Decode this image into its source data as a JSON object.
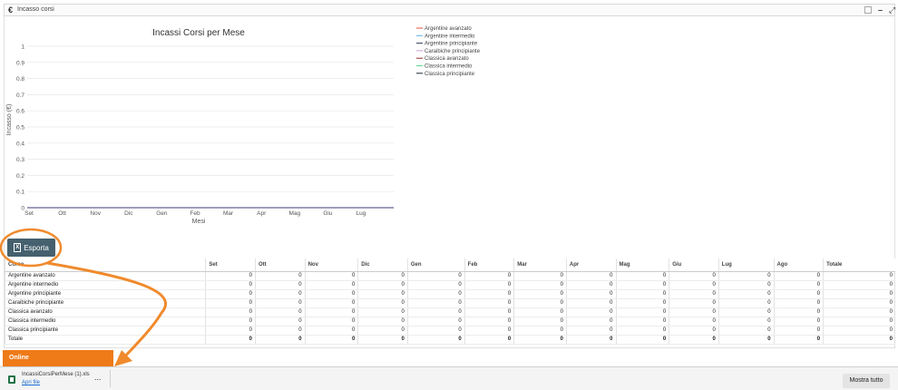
{
  "panel": {
    "icon": "euro-icon",
    "title": "Incasso corsi",
    "controls": [
      "checkbox-icon",
      "minimize-icon",
      "expand-icon"
    ]
  },
  "chart_data": {
    "type": "line",
    "title": "Incassi Corsi per Mese",
    "xlabel": "Mesi",
    "ylabel": "Incasso (€)",
    "categories": [
      "Set",
      "Ott",
      "Nov",
      "Dic",
      "Gen",
      "Feb",
      "Mar",
      "Apr",
      "Mag",
      "Giu",
      "Lug"
    ],
    "ylim": [
      0,
      1
    ],
    "yticks": [
      "0",
      "0.1",
      "0.2",
      "0.3",
      "0.4",
      "0.5",
      "0.6",
      "0.7",
      "0.8",
      "0.9",
      "1"
    ],
    "grid": true,
    "legend_position": "top-right",
    "series": [
      {
        "name": "Argentine avanzato",
        "color": "#e74c3c",
        "values": [
          0,
          0,
          0,
          0,
          0,
          0,
          0,
          0,
          0,
          0,
          0
        ]
      },
      {
        "name": "Argentine intermedio",
        "color": "#5dade2",
        "values": [
          0,
          0,
          0,
          0,
          0,
          0,
          0,
          0,
          0,
          0,
          0
        ]
      },
      {
        "name": "Argentine principiante",
        "color": "#2e4053",
        "values": [
          0,
          0,
          0,
          0,
          0,
          0,
          0,
          0,
          0,
          0,
          0
        ]
      },
      {
        "name": "Caraibiche principiante",
        "color": "#c39bd3",
        "values": [
          0,
          0,
          0,
          0,
          0,
          0,
          0,
          0,
          0,
          0,
          0
        ]
      },
      {
        "name": "Classica avanzato",
        "color": "#922b21",
        "values": [
          0,
          0,
          0,
          0,
          0,
          0,
          0,
          0,
          0,
          0,
          0
        ]
      },
      {
        "name": "Classica intermedio",
        "color": "#58d68d",
        "values": [
          0,
          0,
          0,
          0,
          0,
          0,
          0,
          0,
          0,
          0,
          0
        ]
      },
      {
        "name": "Classica principiante",
        "color": "#1c2833",
        "values": [
          0,
          0,
          0,
          0,
          0,
          0,
          0,
          0,
          0,
          0,
          0
        ]
      }
    ]
  },
  "export_button": {
    "label": "Esporta",
    "icon": "excel-icon"
  },
  "table": {
    "headers": [
      "Corso",
      "Set",
      "Ott",
      "Nov",
      "Dic",
      "Gen",
      "Feb",
      "Mar",
      "Apr",
      "Mag",
      "Giu",
      "Lug",
      "Ago",
      "Totale"
    ],
    "rows": [
      {
        "name": "Argentine avanzato",
        "values": [
          "0",
          "0",
          "0",
          "0",
          "0",
          "0",
          "0",
          "0",
          "0",
          "0",
          "0",
          "0",
          "0"
        ]
      },
      {
        "name": "Argentine intermedio",
        "values": [
          "0",
          "0",
          "0",
          "0",
          "0",
          "0",
          "0",
          "0",
          "0",
          "0",
          "0",
          "0",
          "0"
        ]
      },
      {
        "name": "Argentine principiante",
        "values": [
          "0",
          "0",
          "0",
          "0",
          "0",
          "0",
          "0",
          "0",
          "0",
          "0",
          "0",
          "0",
          "0"
        ]
      },
      {
        "name": "Caraibiche principiante",
        "values": [
          "0",
          "0",
          "0",
          "0",
          "0",
          "0",
          "0",
          "0",
          "0",
          "0",
          "0",
          "0",
          "0"
        ]
      },
      {
        "name": "Classica avanzato",
        "values": [
          "0",
          "0",
          "0",
          "0",
          "0",
          "0",
          "0",
          "0",
          "0",
          "0",
          "0",
          "0",
          "0"
        ]
      },
      {
        "name": "Classica intermedio",
        "values": [
          "0",
          "0",
          "0",
          "0",
          "0",
          "0",
          "0",
          "0",
          "0",
          "0",
          "0",
          "0",
          "0"
        ]
      },
      {
        "name": "Classica principiante",
        "values": [
          "0",
          "0",
          "0",
          "0",
          "0",
          "0",
          "0",
          "0",
          "0",
          "0",
          "0",
          "0",
          "0"
        ]
      }
    ],
    "total_row": {
      "name": "Totale",
      "values": [
        "0",
        "0",
        "0",
        "0",
        "0",
        "0",
        "0",
        "0",
        "0",
        "0",
        "0",
        "0",
        "0"
      ]
    }
  },
  "status_bar": {
    "label": "Online",
    "color": "#ef7a18"
  },
  "download_bar": {
    "file_name": "IncassiCorsiPerMese (1).xls",
    "open_link": "Apri file",
    "more": "...",
    "show_all": "Mostra tutto"
  },
  "annotation": {
    "color": "#f08a2c"
  }
}
